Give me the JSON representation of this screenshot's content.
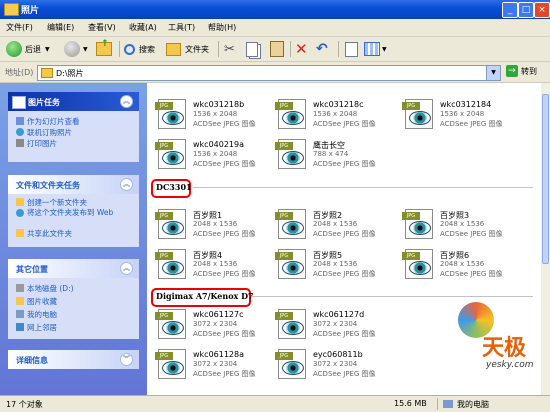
{
  "window": {
    "title": "照片"
  },
  "menu": [
    "文件(F)",
    "编辑(E)",
    "查看(V)",
    "收藏(A)",
    "工具(T)",
    "帮助(H)"
  ],
  "toolbar": {
    "back_label": "后退",
    "search_label": "搜索",
    "folders_label": "文件夹"
  },
  "address": {
    "label": "地址(D)",
    "value": "D:\\照片",
    "go_label": "转到"
  },
  "left_panels": [
    {
      "title": "图片任务",
      "items": [
        "作为幻灯片查看",
        "联机订购照片",
        "打印图片"
      ]
    },
    {
      "title": "文件和文件夹任务",
      "items": [
        "创建一个新文件夹",
        "将这个文件夹发布到 Web",
        "共享此文件夹"
      ]
    },
    {
      "title": "其它位置",
      "items": [
        "本地磁盘 (D:)",
        "图片收藏",
        "我的电脑",
        "网上邻居"
      ]
    },
    {
      "title": "详细信息",
      "items": []
    }
  ],
  "groups": {
    "g1": "DC3301",
    "g2": "Digimax A7/Kenox D7"
  },
  "files": [
    {
      "name": "wkc031218b",
      "dims": "1536 x 2048",
      "type": "ACDSee JPEG 图像"
    },
    {
      "name": "wkc031218c",
      "dims": "1536 x 2048",
      "type": "ACDSee JPEG 图像"
    },
    {
      "name": "wkc0312184",
      "dims": "1536 x 2048",
      "type": "ACDSee JPEG 图像"
    },
    {
      "name": "wkc040219a",
      "dims": "1536 x 2048",
      "type": "ACDSee JPEG 图像"
    },
    {
      "name": "鹰击长空",
      "dims": "788 x 474",
      "type": "ACDSee JPEG 图像"
    },
    {
      "name": "百岁照1",
      "dims": "2048 x 1536",
      "type": "ACDSee JPEG 图像"
    },
    {
      "name": "百岁照2",
      "dims": "2048 x 1536",
      "type": "ACDSee JPEG 图像"
    },
    {
      "name": "百岁照3",
      "dims": "2048 x 1536",
      "type": "ACDSee JPEG 图像"
    },
    {
      "name": "百岁照4",
      "dims": "2048 x 1536",
      "type": "ACDSee JPEG 图像"
    },
    {
      "name": "百岁照5",
      "dims": "2048 x 1536",
      "type": "ACDSee JPEG 图像"
    },
    {
      "name": "百岁照6",
      "dims": "2048 x 1536",
      "type": "ACDSee JPEG 图像"
    },
    {
      "name": "wkc061127c",
      "dims": "3072 x 2304",
      "type": "ACDSee JPEG 图像"
    },
    {
      "name": "wkc061127d",
      "dims": "3072 x 2304",
      "type": "ACDSee JPEG 图像"
    },
    {
      "name": "wkc061128a",
      "dims": "3072 x 2304",
      "type": "ACDSee JPEG 图像"
    },
    {
      "name": "eyc060811b",
      "dims": "3072 x 2304",
      "type": "ACDSee JPEG 图像"
    }
  ],
  "icon_tag": "JPG",
  "status": {
    "count": "17 个对象",
    "size": "15.6 MB",
    "location": "我的电脑"
  },
  "watermark": {
    "text": "天极",
    "domain": "yesky.com"
  }
}
